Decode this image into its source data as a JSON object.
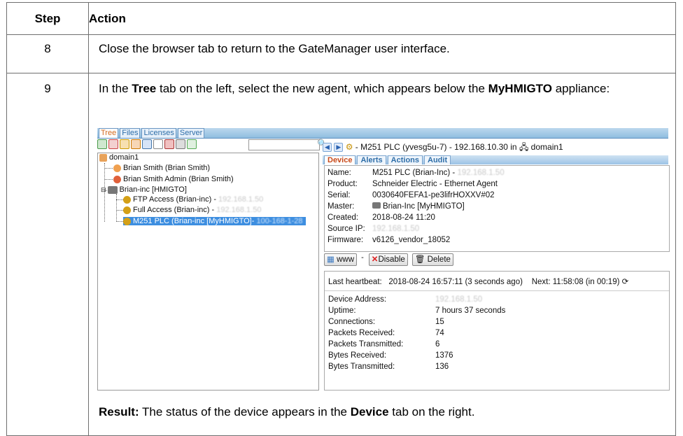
{
  "header": {
    "step": "Step",
    "action": "Action"
  },
  "row8": {
    "step": "8",
    "action": "Close the browser tab to return to the GateManager user interface."
  },
  "row9": {
    "step": "9",
    "text_pre": "In the ",
    "text_tree": "Tree",
    "text_mid": " tab on the left, select the new agent, which appears below the ",
    "text_appliance": "MyHMIGTO",
    "text_post": " appliance:",
    "result_label": "Result:",
    "result_pre": " The status of the device appears in the ",
    "result_device": "Device",
    "result_post": " tab on the right."
  },
  "screenshot": {
    "tabs": [
      "Tree",
      "Files",
      "Licenses",
      "Server"
    ],
    "tree": {
      "root": "domain1",
      "items": [
        {
          "label": "Brian Smith (Brian Smith)"
        },
        {
          "label": "Brian Smith Admin (Brian Smith)"
        },
        {
          "label": "Brian-inc [HMIGTO]"
        },
        {
          "label": "FTP Access (Brian-inc) - ",
          "blur": "192.168.1.50"
        },
        {
          "label": "Full Access (Brian-inc) - ",
          "blur": "192.168.1.50"
        },
        {
          "label": "M251 PLC (Brian-inc [MyHMIGTO]- ",
          "blur": "100-168-1-28"
        }
      ]
    },
    "nav_title": "- M251 PLC (yvesg5u-7) - 192.168.10.30 in",
    "nav_domain": "domain1",
    "device_tabs": [
      "Device",
      "Alerts",
      "Actions",
      "Audit"
    ],
    "device_info": {
      "name_k": "Name:",
      "name_v": "M251 PLC (Brian-Inc) - ",
      "name_blur": "192.168.1.50",
      "product_k": "Product:",
      "product_v": "Schneider Electric - Ethernet Agent",
      "serial_k": "Serial:",
      "serial_v": "0030640FEFA1-pe3lifrHOXXV#02",
      "master_k": "Master:",
      "master_v": "Brian-Inc [MyHMIGTO]",
      "created_k": "Created:",
      "created_v": "2018-08-24 11:20",
      "source_k": "Source IP:",
      "source_blur": "192.168.1.50",
      "firmware_k": "Firmware:",
      "firmware_v": "v6126_vendor_18052"
    },
    "buttons": {
      "www": "www",
      "sep": "-",
      "disable": "Disable",
      "delete": "Delete"
    },
    "heartbeat": {
      "label": "Last heartbeat:",
      "value": "2018-08-24  16:57:11 (3 seconds ago)",
      "next": "Next: 11:58:08 (in 00:19)"
    },
    "stats": {
      "addr_k": "Device Address:",
      "addr_blur": "192.168.1.50",
      "uptime_k": "Uptime:",
      "uptime_v": "7 hours 37 seconds",
      "conn_k": "Connections:",
      "conn_v": "15",
      "prx_k": "Packets Received:",
      "prx_v": "74",
      "ptx_k": "Packets Transmitted:",
      "ptx_v": "6",
      "brx_k": "Bytes Received:",
      "brx_v": "1376",
      "btx_k": "Bytes Transmitted:",
      "btx_v": "136"
    }
  }
}
